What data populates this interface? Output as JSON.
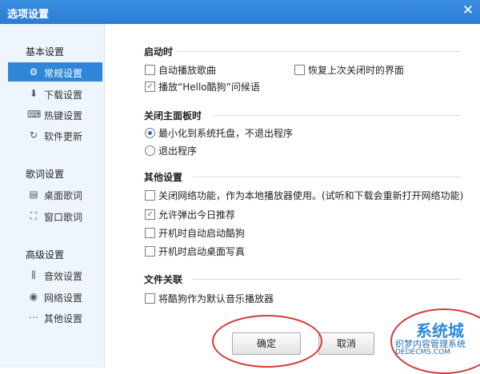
{
  "window": {
    "title": "选项设置",
    "close_glyph": "✕"
  },
  "sidebar": {
    "groups": [
      {
        "title": "基本设置",
        "items": [
          {
            "label": "常规设置",
            "icon": "gear-icon",
            "glyph": "⚙",
            "active": true
          },
          {
            "label": "下载设置",
            "icon": "download-icon",
            "glyph": "⬇"
          },
          {
            "label": "热键设置",
            "icon": "keyboard-icon",
            "glyph": "⌨"
          },
          {
            "label": "软件更新",
            "icon": "update-icon",
            "glyph": "↻"
          }
        ]
      },
      {
        "title": "歌词设置",
        "items": [
          {
            "label": "桌面歌词",
            "icon": "desktop-lyrics-icon",
            "glyph": "▤"
          },
          {
            "label": "窗口歌词",
            "icon": "window-lyrics-icon",
            "glyph": "⛶"
          }
        ]
      },
      {
        "title": "高级设置",
        "items": [
          {
            "label": "音效设置",
            "icon": "equalizer-icon",
            "glyph": "⫼"
          },
          {
            "label": "网络设置",
            "icon": "network-icon",
            "glyph": "◉"
          },
          {
            "label": "其他设置",
            "icon": "more-icon",
            "glyph": "⋯"
          }
        ]
      }
    ]
  },
  "main": {
    "startup": {
      "title": "启动时",
      "autoplay": "自动播放歌曲",
      "restore": "恢复上次关闭时的界面",
      "greeting": "播放“Hello酷狗”问候语"
    },
    "close_panel": {
      "title": "关闭主面板时",
      "minimize": "最小化到系统托盘，不退出程序",
      "exit": "退出程序"
    },
    "other": {
      "title": "其他设置",
      "disable_network": "关闭网络功能，作为本地播放器使用。(试听和下载会重新打开网络功能)",
      "daily_recommend": "允许弹出今日推荐",
      "autostart": "开机时自动启动酷狗",
      "desktop_photo": "开机时启动桌面写真"
    },
    "file_assoc": {
      "title": "文件关联",
      "default_player": "将酷狗作为默认音乐播放器"
    }
  },
  "checked_glyph": "✓",
  "buttons": {
    "ok": "确定",
    "cancel": "取消"
  },
  "watermark": {
    "line1": "系统城",
    "line2": "织梦内容管理系统",
    "line3": "DEDECMS.COM"
  },
  "colors": {
    "title_bar": "#2a7bd4",
    "active_nav": "#2f86d8",
    "annotation_circle": "#d43a3a"
  }
}
